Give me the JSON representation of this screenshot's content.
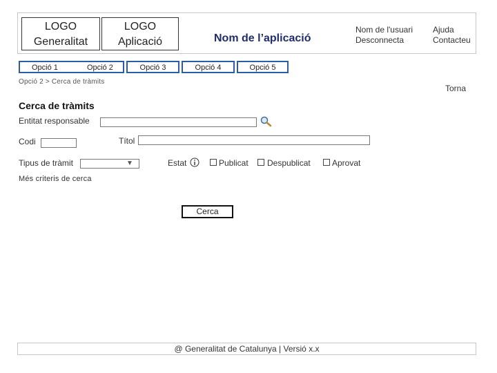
{
  "header": {
    "logo_generalitat_line1": "LOGO",
    "logo_generalitat_line2": "Generalitat",
    "logo_app_line1": "LOGO",
    "logo_app_line2": "Aplicació",
    "app_name": "Nom de l’aplicació",
    "user_name": "Nom de l'usuari",
    "logout": "Desconnecta",
    "help": "Ajuda",
    "contact": "Contacteu"
  },
  "nav": {
    "items": [
      {
        "label": "Opció 1"
      },
      {
        "label": "Opció 2"
      },
      {
        "label": "Opció 3"
      },
      {
        "label": "Opció 4"
      },
      {
        "label": "Opció 5"
      }
    ]
  },
  "breadcrumb": "Opció 2 > Cerca de tràmits",
  "back_link": "Torna",
  "form": {
    "title": "Cerca de tràmits",
    "entitat_label": "Entitat responsable",
    "entitat_value": "",
    "codi_label": "Codi",
    "codi_value": "",
    "titol_label": "Títol",
    "titol_value": "",
    "tipus_label": "Tipus de tràmit",
    "tipus_selected": "",
    "estat_label": "Estat",
    "estat_options": [
      "Publicat",
      "Despublicat",
      "Aprovat"
    ],
    "more_criteria": "Més criteris de cerca",
    "search_button": "Cerca"
  },
  "footer": "@ Generalitat de Catalunya | Versió x.x",
  "icons": {
    "search": "search-icon",
    "info": "info-icon",
    "dropdown": "chevron-down-icon"
  }
}
